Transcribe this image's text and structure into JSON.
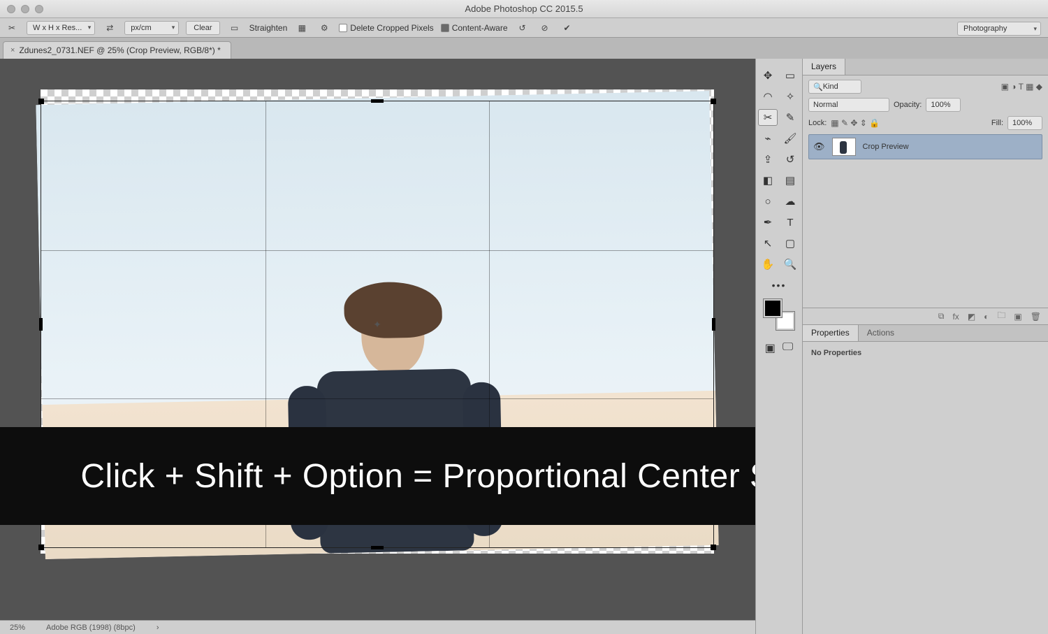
{
  "app": {
    "title": "Adobe Photoshop CC 2015.5"
  },
  "workspace_preset": "Photography",
  "optbar": {
    "ratio_preset": "W x H x Res...",
    "unit": "px/cm",
    "clear": "Clear",
    "straighten": "Straighten",
    "delete_cropped": {
      "label": "Delete Cropped Pixels",
      "checked": false
    },
    "content_aware": {
      "label": "Content-Aware",
      "checked": true
    }
  },
  "document": {
    "tab_title": "Zdunes2_0731.NEF @ 25% (Crop Preview, RGB/8*) *",
    "zoom": "25%",
    "color_profile": "Adobe RGB (1998) (8bpc)"
  },
  "tools": {
    "col1": [
      "move",
      "lasso",
      "crop",
      "eyedropper",
      "clone",
      "eraser",
      "blur",
      "pen",
      "path-select",
      "hand",
      "more"
    ],
    "col2": [
      "marquee",
      "magic-wand",
      "slice",
      "brush",
      "history-brush",
      "gradient",
      "dodge",
      "type",
      "rectangle",
      "zoom"
    ]
  },
  "layers": {
    "tab": "Layers",
    "filter_placeholder": "Kind",
    "blend_mode": "Normal",
    "opacity_label": "Opacity:",
    "opacity_value": "100%",
    "lock_label": "Lock:",
    "fill_label": "Fill:",
    "fill_value": "100%",
    "items": [
      {
        "name": "Crop Preview",
        "visible": true
      }
    ]
  },
  "properties": {
    "tabs": [
      "Properties",
      "Actions"
    ],
    "empty": "No Properties"
  },
  "banner": "Click + Shift + Option = Proportional Center Scale"
}
